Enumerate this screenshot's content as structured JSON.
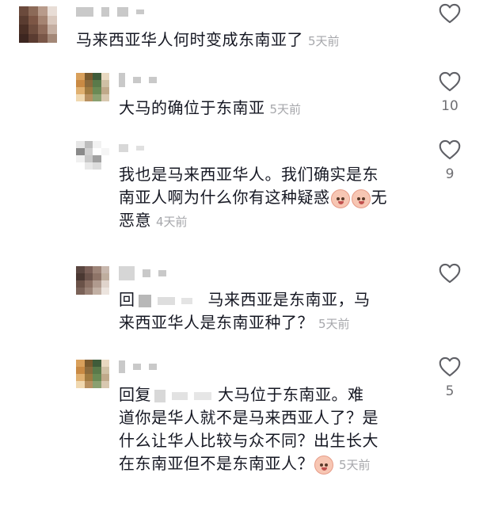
{
  "comments": [
    {
      "text": "马来西亚华人何时变成东南亚了",
      "time": "5天前",
      "likes": "",
      "avatar_colors": [
        "#6b4a3c",
        "#8c6a58",
        "#b89b8b",
        "#e8ddd6",
        "#5a3c30",
        "#7d5645",
        "#a58472",
        "#d9c8bd",
        "#4a2f25",
        "#6e4c3d",
        "#8f6b5a",
        "#c4aea1",
        "#3d2620",
        "#5b3c31",
        "#7a5748",
        "#a38777"
      ]
    },
    {
      "text": "大马的确位于东南亚",
      "time": "5天前",
      "likes": "10",
      "avatar_colors": [
        "#d9a05b",
        "#7a5a2e",
        "#3f5c3a",
        "#e8d8c0",
        "#c98a44",
        "#8b6a3c",
        "#5a7a4a",
        "#cfc0a4",
        "#e0b070",
        "#a07a40",
        "#6a8a55",
        "#bfa98a",
        "#f0d8b0",
        "#b89060",
        "#8aa070",
        "#d8c8b0"
      ]
    },
    {
      "text_lines": [
        "我也是马来西亚华人。我们确实是东",
        "南亚人啊为什么你有这种疑惑",
        "恶意"
      ],
      "after_emoji": "无",
      "time": "4天前",
      "likes": "9",
      "emoji_icon": "laughing-face-icon",
      "avatar_colors": [
        "#e6e6e6",
        "#bdbdbd",
        "#f2f2f2",
        "#ffffff",
        "#8a8a8a",
        "#d0d0d0",
        "#ffffff",
        "#f5f5f5",
        "#f0f0f0",
        "#c8c8c8",
        "#a0a0a0",
        "#ffffff",
        "#ffffff",
        "#e8e8e8",
        "#dcdcdc",
        "#ffffff"
      ]
    },
    {
      "reply_prefix": "回",
      "text_lines": [
        "马来西亚是东南亚，马",
        "来西亚华人是东南亚种了？"
      ],
      "time": "5天前",
      "likes": "",
      "avatar_colors": [
        "#5a4640",
        "#7b6058",
        "#9d8478",
        "#c8b8ae",
        "#4a3832",
        "#6c544c",
        "#8e7468",
        "#bfae9f",
        "#6a5248",
        "#8b7064",
        "#b09a8e",
        "#e0d4cc",
        "#7a6258",
        "#9a8276",
        "#c2b0a4",
        "#ece4de"
      ]
    },
    {
      "reply_prefix": "回复",
      "text_lines": [
        "大马位于东南亚。难",
        "道你是华人就不是马来西亚人了？是",
        "什么让华人比较与众不同？出生长大",
        "在东南亚但不是东南亚人？"
      ],
      "time": "5天前",
      "likes": "5",
      "emoji_icon": "laughing-face-icon",
      "avatar_colors": [
        "#d9a05b",
        "#7a5a2e",
        "#3f5c3a",
        "#e8d8c0",
        "#c98a44",
        "#8b6a3c",
        "#5a7a4a",
        "#cfc0a4",
        "#e0b070",
        "#a07a40",
        "#6a8a55",
        "#bfa98a",
        "#f0d8b0",
        "#b89060",
        "#8aa070",
        "#d8c8b0"
      ]
    }
  ],
  "colors": {
    "text": "#161823",
    "time": "#a6a7ab",
    "count": "#6f6f73",
    "heart": "#5f6066"
  },
  "icons": {
    "like": "heart-outline-icon",
    "emoji": "laughing-face-icon"
  }
}
